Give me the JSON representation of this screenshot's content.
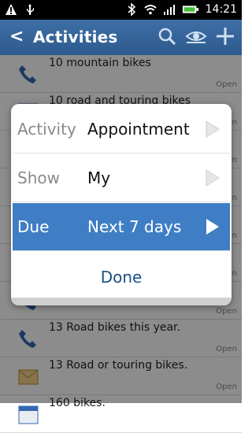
{
  "status_bar": {
    "time": "14:21"
  },
  "action_bar": {
    "title": "Activities",
    "back_glyph": "<"
  },
  "list": [
    {
      "title": "10 mountain bikes",
      "status": "Open",
      "icon": "phone-icon"
    },
    {
      "title": "10 road and touring bikes",
      "status": "Open",
      "icon": "calendar-icon"
    },
    {
      "title": "",
      "status": "Open",
      "icon": "mail-icon"
    },
    {
      "title": "",
      "status": "Open",
      "icon": "phone-icon"
    },
    {
      "title": "",
      "status": "Open",
      "icon": "calendar-icon"
    },
    {
      "title": "",
      "status": "Open",
      "icon": "mail-icon"
    },
    {
      "title": "",
      "status": "Open",
      "icon": "phone-icon"
    },
    {
      "title": "13 Road bikes this year.",
      "status": "Open",
      "icon": "phone-icon"
    },
    {
      "title": "13 Road or touring bikes.",
      "status": "Open",
      "icon": "mail-icon"
    },
    {
      "title": "160 bikes.",
      "status": "",
      "icon": "calendar-icon"
    }
  ],
  "dialog": {
    "rows": [
      {
        "key": "Activity",
        "value": "Appointment"
      },
      {
        "key": "Show",
        "value": "My"
      },
      {
        "key": "Due",
        "value": "Next 7 days"
      }
    ],
    "done_label": "Done"
  }
}
